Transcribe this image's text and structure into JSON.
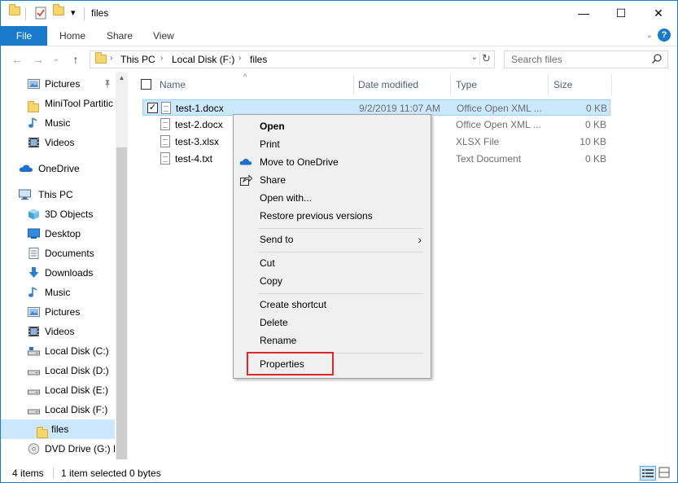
{
  "titlebar": {
    "title": "files",
    "qa_dropdown": "▾",
    "minimize": "—",
    "maximize": "☐",
    "close": "✕"
  },
  "ribbon": {
    "tabs": [
      {
        "label": "File"
      },
      {
        "label": "Home"
      },
      {
        "label": "Share"
      },
      {
        "label": "View"
      }
    ],
    "collapse": "⌄",
    "help": "?"
  },
  "nav": {
    "back": "←",
    "forward": "→",
    "recent": "⌄",
    "up": "↑",
    "breadcrumbs": [
      "This PC",
      "Local Disk (F:)",
      "files"
    ],
    "crumb_arrow": "›",
    "address_dropdown": "⌄",
    "refresh": "↻",
    "search_placeholder": "Search files"
  },
  "navpane": {
    "items": [
      {
        "label": "Pictures",
        "icon": "pictures-icon",
        "pinned": true
      },
      {
        "label": "MiniTool Partitic",
        "icon": "folder-icon"
      },
      {
        "label": "Music",
        "icon": "music-icon"
      },
      {
        "label": "Videos",
        "icon": "videos-icon"
      },
      {
        "label": "OneDrive",
        "icon": "onedrive-icon"
      },
      {
        "label": "This PC",
        "icon": "this-pc-icon"
      },
      {
        "label": "3D Objects",
        "icon": "3d-objects-icon"
      },
      {
        "label": "Desktop",
        "icon": "desktop-icon"
      },
      {
        "label": "Documents",
        "icon": "documents-icon"
      },
      {
        "label": "Downloads",
        "icon": "downloads-icon"
      },
      {
        "label": "Music",
        "icon": "music-icon"
      },
      {
        "label": "Pictures",
        "icon": "pictures-icon"
      },
      {
        "label": "Videos",
        "icon": "videos-icon"
      },
      {
        "label": "Local Disk (C:)",
        "icon": "drive-icon"
      },
      {
        "label": "Local Disk (D:)",
        "icon": "drive-icon"
      },
      {
        "label": "Local Disk (E:)",
        "icon": "drive-icon"
      },
      {
        "label": "Local Disk (F:)",
        "icon": "drive-icon"
      },
      {
        "label": "files",
        "icon": "folder-icon",
        "selected": true
      },
      {
        "label": "DVD Drive (G:) D",
        "icon": "dvd-icon"
      }
    ],
    "pin_glyph": "📌"
  },
  "filelist": {
    "columns": {
      "name": "Name",
      "date": "Date modified",
      "type": "Type",
      "size": "Size"
    },
    "sort_glyph": "^",
    "rows": [
      {
        "name": "test-1.docx",
        "date": "9/2/2019 11:07 AM",
        "type": "Office Open XML ...",
        "size": "0 KB",
        "selected": true
      },
      {
        "name": "test-2.docx",
        "date": "",
        "type": "Office Open XML ...",
        "size": "0 KB"
      },
      {
        "name": "test-3.xlsx",
        "date": "",
        "type": "XLSX File",
        "size": "10 KB"
      },
      {
        "name": "test-4.txt",
        "date": "",
        "type": "Text Document",
        "size": "0 KB"
      }
    ],
    "check_glyph": "✓"
  },
  "context_menu": {
    "items": [
      {
        "label": "Open",
        "bold": true
      },
      {
        "label": "Print"
      },
      {
        "label": "Move to OneDrive",
        "icon": "onedrive-icon"
      },
      {
        "label": "Share",
        "icon": "share-icon"
      },
      {
        "label": "Open with..."
      },
      {
        "label": "Restore previous versions"
      },
      {
        "label": "Send to",
        "submenu": true
      },
      {
        "label": "Cut"
      },
      {
        "label": "Copy"
      },
      {
        "label": "Create shortcut"
      },
      {
        "label": "Delete"
      },
      {
        "label": "Rename"
      },
      {
        "label": "Properties"
      }
    ],
    "submenu_glyph": "›"
  },
  "status": {
    "count": "4 items",
    "selection": "1 item selected  0 bytes"
  },
  "colors": {
    "accent": "#1979ca",
    "selection": "#cce8ff",
    "highlight_box": "#e0262b"
  }
}
